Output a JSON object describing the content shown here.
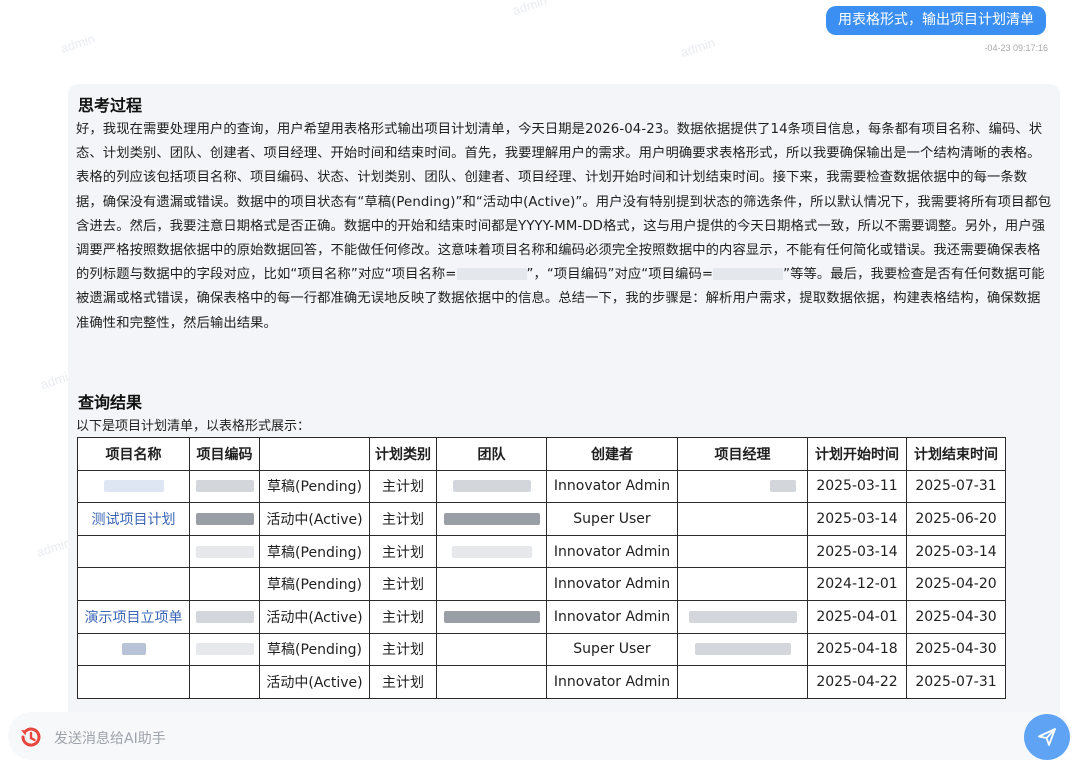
{
  "watermark_text": "admin",
  "user_message": {
    "text": "用表格形式，输出项目计划清单",
    "timestamp": "-04-23 09:17:16"
  },
  "thinking": {
    "title": "思考过程",
    "p1": "好，我现在需要处理用户的查询，用户希望用表格形式输出项目计划清单，今天日期是2026-04-23。数据依据提供了14条项目信息，每条都有项目名称、编码、状态、计划类别、团队、创建者、项目经理、开始时间和结束时间。首先，我要理解用户的需求。用户明确要求表格形式，所以我要确保输出是一个结构清晰的表格。表格的列应该包括项目名称、项目编码、状态、计划类别、团队、创建者、项目经理、计划开始时间和计划结束时间。接下来，我需要检查数据依据中的每一条数据，确保没有遗漏或错误。数据中的项目状态有“草稿(Pending)”和“活动中(Active)”。用户没有特别提到状态的筛选条件，所以默认情况下，我需要将所有项目都包含进去。然后，我要注意日期格式是否正确。数据中的开始和结束时间都是YYYY-MM-DD格式，这与用户提供的今天日期格式一致，所以不需要调整。另外，用户强调要严格按照数据依据中的原始数据回答，不能做任何修改。这意味着项目名称和编码必须完全按照数据中的内容显示，不能有任何简化或错误。我还需要确保表格的列标题与数据中的字段对应，比如“项目名称”对应“项目名称=",
    "p2": "”，“项目编码”对应“项目编码=",
    "p3": "”等等。最后，我要检查是否有任何数据可能被遗漏或格式错误，确保表格中的每一行都准确无误地反映了数据依据中的信息。总结一下，我的步骤是：解析用户需求，提取数据依据，构建表格结构，确保数据准确性和完整性，然后输出结果。"
  },
  "result": {
    "title": "查询结果",
    "intro": "以下是项目计划清单，以表格形式展示：",
    "headers": [
      "项目名称",
      "项目编码",
      "",
      "计划类别",
      "团队",
      "创建者",
      "项目经理",
      "计划开始时间",
      "计划结束时间"
    ],
    "rows": [
      {
        "name": "",
        "status": "草稿(Pending)",
        "category": "主计划",
        "creator": "Innovator Admin",
        "start": "2025-03-11",
        "end": "2025-07-31"
      },
      {
        "name": "测试项目计划",
        "status": "活动中(Active)",
        "category": "主计划",
        "creator": "Super User",
        "start": "2025-03-14",
        "end": "2025-06-20"
      },
      {
        "name": "",
        "status": "草稿(Pending)",
        "category": "主计划",
        "creator": "Innovator Admin",
        "start": "2025-03-14",
        "end": "2025-03-14"
      },
      {
        "name": "",
        "status": "草稿(Pending)",
        "category": "主计划",
        "creator": "Innovator Admin",
        "start": "2024-12-01",
        "end": "2025-04-20"
      },
      {
        "name": "演示项目立项单",
        "status": "活动中(Active)",
        "category": "主计划",
        "creator": "Innovator Admin",
        "start": "2025-04-01",
        "end": "2025-04-30"
      },
      {
        "name": "",
        "status": "草稿(Pending)",
        "category": "主计划",
        "creator": "Super User",
        "start": "2025-04-18",
        "end": "2025-04-30"
      },
      {
        "name": "",
        "status": "活动中(Active)",
        "category": "主计划",
        "creator": "Innovator Admin",
        "start": "2025-04-22",
        "end": "2025-07-31"
      }
    ]
  },
  "input": {
    "placeholder": "发送消息给AI助手"
  },
  "icons": {
    "history": "history-icon",
    "send": "send-icon"
  },
  "colors": {
    "accent": "#3b8ff3",
    "link": "#3a66b5",
    "history_icon": "#e8473d"
  }
}
